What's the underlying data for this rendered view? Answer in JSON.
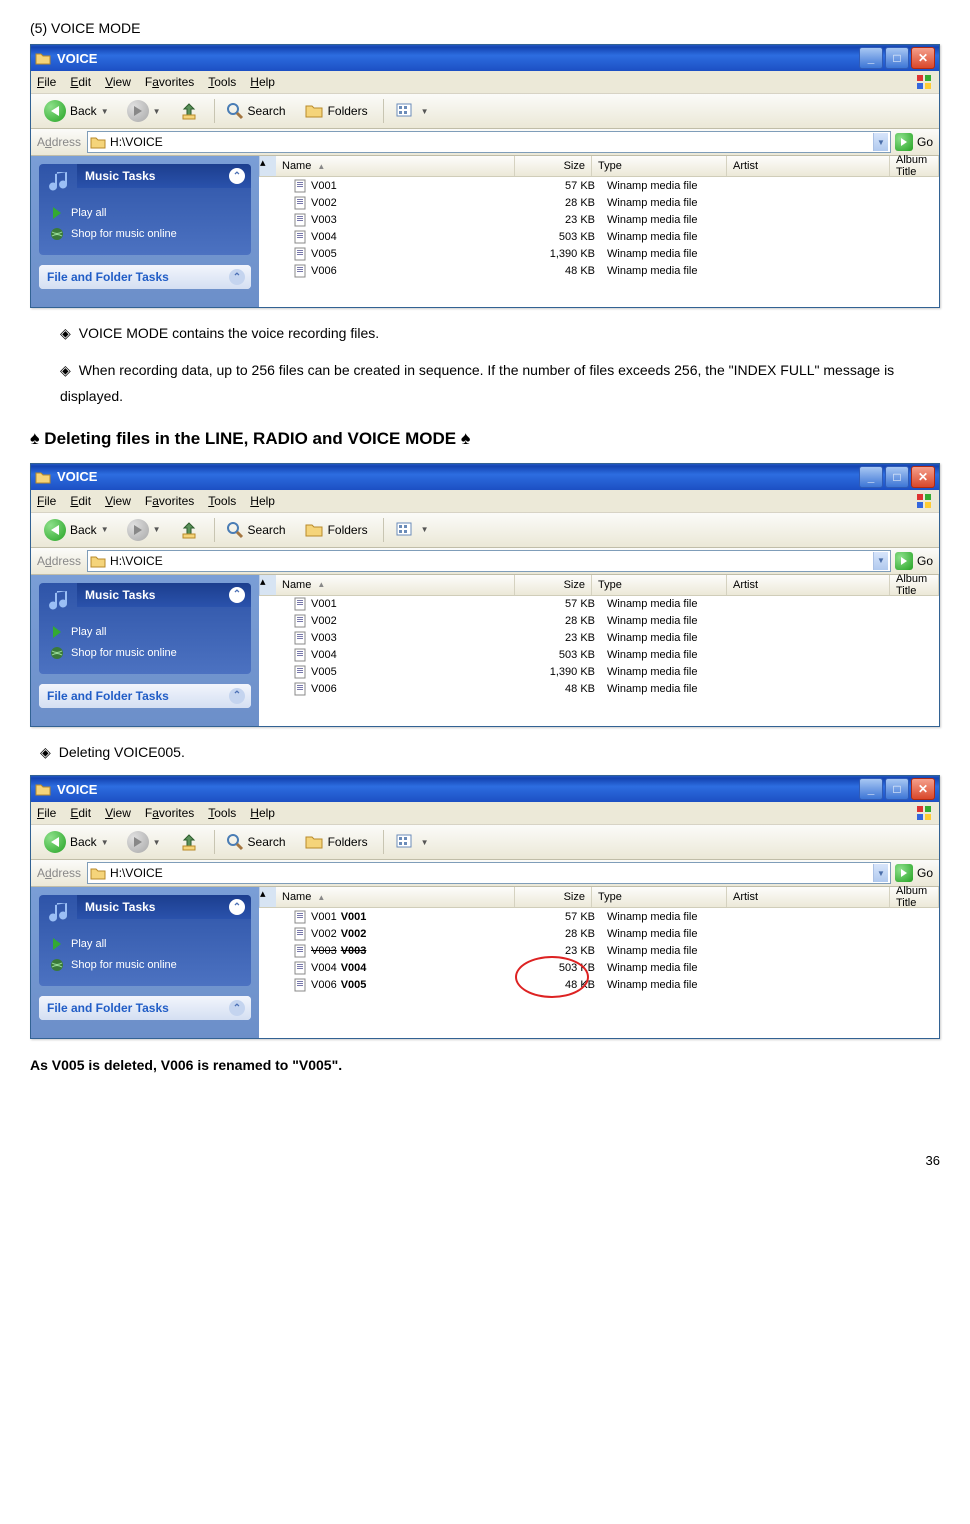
{
  "page": {
    "section_label": "(5) VOICE MODE",
    "bullet1": "VOICE MODE contains the voice recording files.",
    "bullet2": "When recording data, up to 256 files can be created in sequence. If the number of files exceeds 256, the \"INDEX FULL\" message is displayed.",
    "heading2": "Deleting files in the LINE, RADIO and VOICE MODE",
    "bullet3": "Deleting VOICE005.",
    "conclusion": "As V005 is deleted, V006 is renamed to \"V005\".",
    "number": "36"
  },
  "win": {
    "title": "VOICE",
    "menu": {
      "file": "File",
      "edit": "Edit",
      "view": "View",
      "favorites": "Favorites",
      "tools": "Tools",
      "help": "Help"
    },
    "toolbar": {
      "back": "Back",
      "search": "Search",
      "folders": "Folders"
    },
    "address": {
      "label": "Address",
      "path": "H:\\VOICE",
      "go": "Go"
    },
    "sidebar": {
      "music_tasks": "Music Tasks",
      "play_all": "Play all",
      "shop": "Shop for music online",
      "file_tasks": "File and Folder Tasks"
    },
    "cols": {
      "name": "Name",
      "size": "Size",
      "type": "Type",
      "artist": "Artist",
      "album": "Album Title"
    }
  },
  "files6": [
    {
      "name": "V001",
      "size": "57 KB",
      "type": "Winamp media file"
    },
    {
      "name": "V002",
      "size": "28 KB",
      "type": "Winamp media file"
    },
    {
      "name": "V003",
      "size": "23 KB",
      "type": "Winamp media file"
    },
    {
      "name": "V004",
      "size": "503 KB",
      "type": "Winamp media file"
    },
    {
      "name": "V005",
      "size": "1,390 KB",
      "type": "Winamp media file"
    },
    {
      "name": "V006",
      "size": "48 KB",
      "type": "Winamp media file"
    }
  ],
  "files5": [
    {
      "orig": "V001",
      "rename": "V001",
      "size": "57 KB",
      "type": "Winamp media file",
      "strike": false
    },
    {
      "orig": "V002",
      "rename": "V002",
      "size": "28 KB",
      "type": "Winamp media file",
      "strike": false
    },
    {
      "orig": "V003",
      "rename": "V003",
      "size": "23 KB",
      "type": "Winamp media file",
      "strike": true
    },
    {
      "orig": "V004",
      "rename": "V004",
      "size": "503 KB",
      "type": "Winamp media file",
      "strike": false
    },
    {
      "orig": "V006",
      "rename": "V005",
      "size": "48 KB",
      "type": "Winamp media file",
      "strike": false
    }
  ]
}
